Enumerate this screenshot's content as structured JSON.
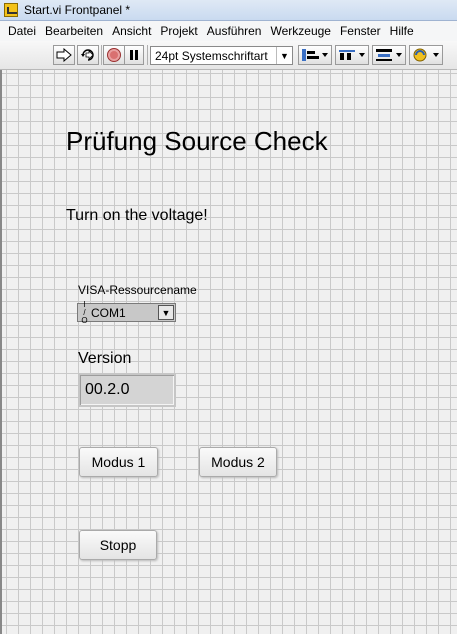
{
  "window": {
    "title": "Start.vi Frontpanel *"
  },
  "menu": [
    "Datei",
    "Bearbeiten",
    "Ansicht",
    "Projekt",
    "Ausführen",
    "Werkzeuge",
    "Fenster",
    "Hilfe"
  ],
  "toolbar": {
    "font_select": "24pt Systemschriftart",
    "icons": [
      "run-arrow-icon",
      "run-continuously-icon",
      "abort-icon",
      "pause-icon",
      "align-icon",
      "distribute-icon",
      "resize-icon",
      "reorder-icon"
    ]
  },
  "panel": {
    "heading": "Prüfung Source Check",
    "message": "Turn on the voltage!",
    "visa": {
      "label": "VISA-Ressourcename",
      "io_icon": "I/O",
      "value": "COM1"
    },
    "version": {
      "label": "Version",
      "value": "00.2.0"
    },
    "buttons": {
      "modus1": "Modus 1",
      "modus2": "Modus 2",
      "stopp": "Stopp"
    }
  }
}
